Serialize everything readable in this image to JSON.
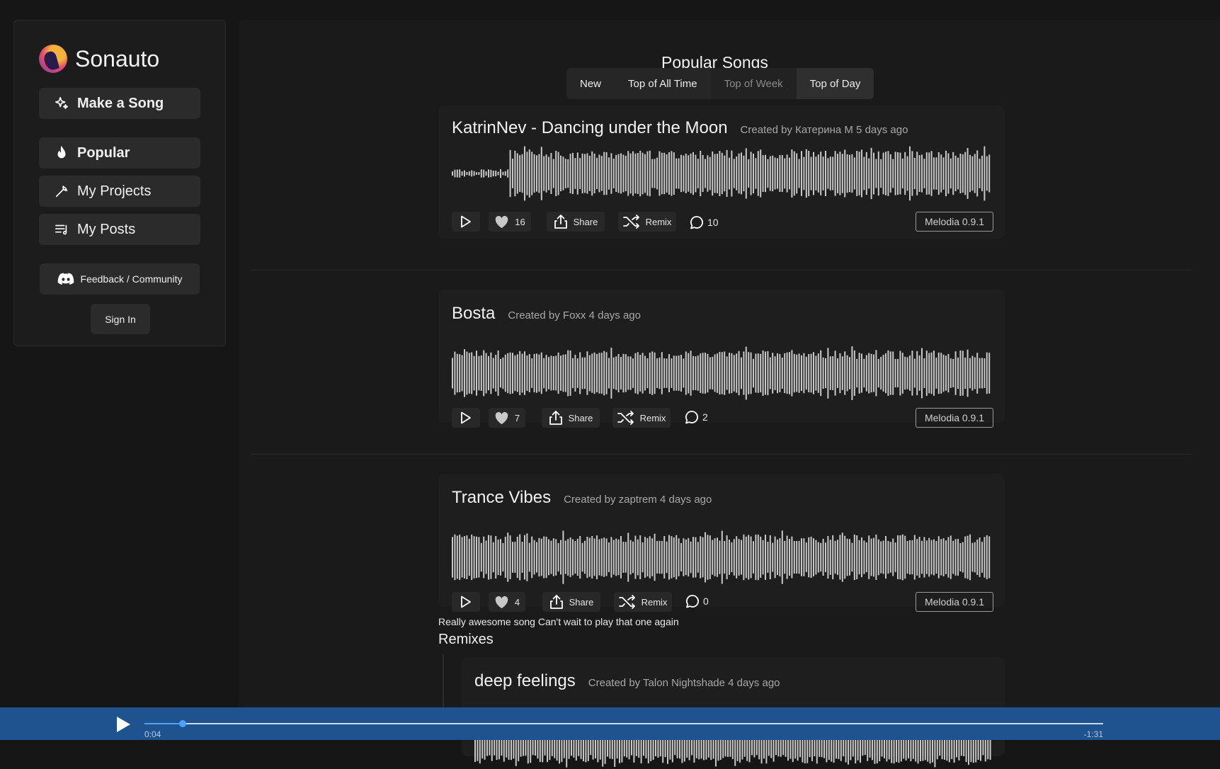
{
  "brand": {
    "name": "Sonauto"
  },
  "sidebar": {
    "make_song": "Make a Song",
    "items": [
      {
        "label": "Popular",
        "icon": "flame-icon"
      },
      {
        "label": "My Projects",
        "icon": "wrench-icon"
      },
      {
        "label": "My Posts",
        "icon": "playlist-icon"
      }
    ],
    "feedback": "Feedback / Community",
    "sign_in": "Sign In"
  },
  "page": {
    "title": "Popular Songs",
    "tabs": [
      {
        "label": "New",
        "state": "normal"
      },
      {
        "label": "Top of All Time",
        "state": "normal"
      },
      {
        "label": "Top of Week",
        "state": "muted"
      },
      {
        "label": "Top of Day",
        "state": "active"
      }
    ]
  },
  "songs": [
    {
      "title": "KatrinNev - Dancing under the Moon",
      "creator": "Created by Катерина M 5 days ago",
      "likes": "16",
      "share": "Share",
      "remix": "Remix",
      "comments": "10",
      "model": "Melodia 0.9.1"
    },
    {
      "title": "Bosta",
      "creator": "Created by Foxx 4 days ago",
      "likes": "7",
      "share": "Share",
      "remix": "Remix",
      "comments": "2",
      "model": "Melodia 0.9.1"
    },
    {
      "title": "Trance Vibes",
      "creator": "Created by zaptrem 4 days ago",
      "likes": "4",
      "share": "Share",
      "remix": "Remix",
      "comments": "0",
      "model": "Melodia 0.9.1",
      "description": "Really awesome song Can't wait to play that one again"
    }
  ],
  "remixes": {
    "heading": "Remixes",
    "items": [
      {
        "title": "deep feelings",
        "creator": "Created by Talon Nightshade 4 days ago"
      }
    ]
  },
  "player": {
    "elapsed": "0:04",
    "remaining": "-1:31",
    "progress": 0.04
  },
  "colors": {
    "background": "#161616",
    "player_bar": "#1f5390",
    "accent": "#4da3ff"
  }
}
